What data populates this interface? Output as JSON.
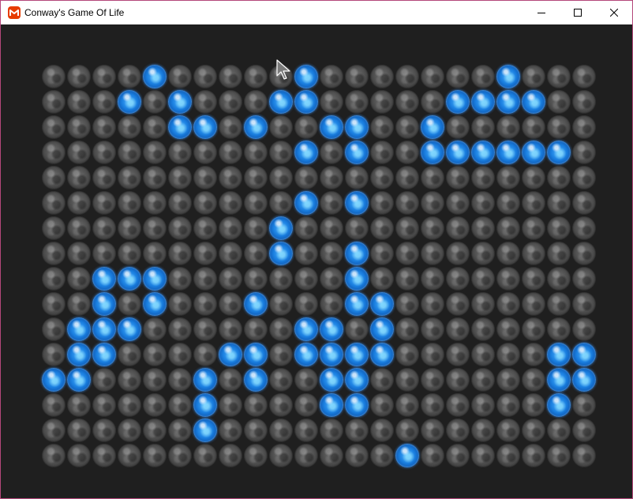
{
  "window": {
    "title": "Conway's Game Of Life",
    "app_icon": "monogame-icon",
    "controls": [
      "minimize-icon",
      "maximize-icon",
      "close-icon"
    ],
    "border_color": "#b4477a"
  },
  "board": {
    "columns": 22,
    "rows": 16,
    "dead_color": "#4a4a4a",
    "alive_color": "#1a7fe0",
    "background": "#1f1f1f",
    "alive_cells": [
      [
        0,
        4
      ],
      [
        0,
        10
      ],
      [
        0,
        18
      ],
      [
        1,
        3
      ],
      [
        1,
        5
      ],
      [
        1,
        9
      ],
      [
        1,
        10
      ],
      [
        1,
        16
      ],
      [
        1,
        17
      ],
      [
        1,
        18
      ],
      [
        1,
        19
      ],
      [
        2,
        5
      ],
      [
        2,
        6
      ],
      [
        2,
        8
      ],
      [
        2,
        11
      ],
      [
        2,
        12
      ],
      [
        2,
        15
      ],
      [
        3,
        10
      ],
      [
        3,
        12
      ],
      [
        3,
        15
      ],
      [
        3,
        16
      ],
      [
        3,
        17
      ],
      [
        3,
        18
      ],
      [
        3,
        19
      ],
      [
        3,
        20
      ],
      [
        5,
        10
      ],
      [
        5,
        12
      ],
      [
        6,
        9
      ],
      [
        7,
        9
      ],
      [
        7,
        12
      ],
      [
        8,
        2
      ],
      [
        8,
        3
      ],
      [
        8,
        4
      ],
      [
        8,
        12
      ],
      [
        9,
        2
      ],
      [
        9,
        4
      ],
      [
        9,
        8
      ],
      [
        9,
        12
      ],
      [
        9,
        13
      ],
      [
        10,
        1
      ],
      [
        10,
        2
      ],
      [
        10,
        3
      ],
      [
        10,
        10
      ],
      [
        10,
        11
      ],
      [
        10,
        13
      ],
      [
        11,
        1
      ],
      [
        11,
        2
      ],
      [
        11,
        7
      ],
      [
        11,
        8
      ],
      [
        11,
        10
      ],
      [
        11,
        11
      ],
      [
        11,
        12
      ],
      [
        11,
        13
      ],
      [
        11,
        20
      ],
      [
        11,
        21
      ],
      [
        12,
        0
      ],
      [
        12,
        1
      ],
      [
        12,
        6
      ],
      [
        12,
        8
      ],
      [
        12,
        11
      ],
      [
        12,
        12
      ],
      [
        12,
        20
      ],
      [
        12,
        21
      ],
      [
        13,
        6
      ],
      [
        13,
        11
      ],
      [
        13,
        12
      ],
      [
        13,
        20
      ],
      [
        14,
        6
      ],
      [
        15,
        14
      ]
    ]
  }
}
